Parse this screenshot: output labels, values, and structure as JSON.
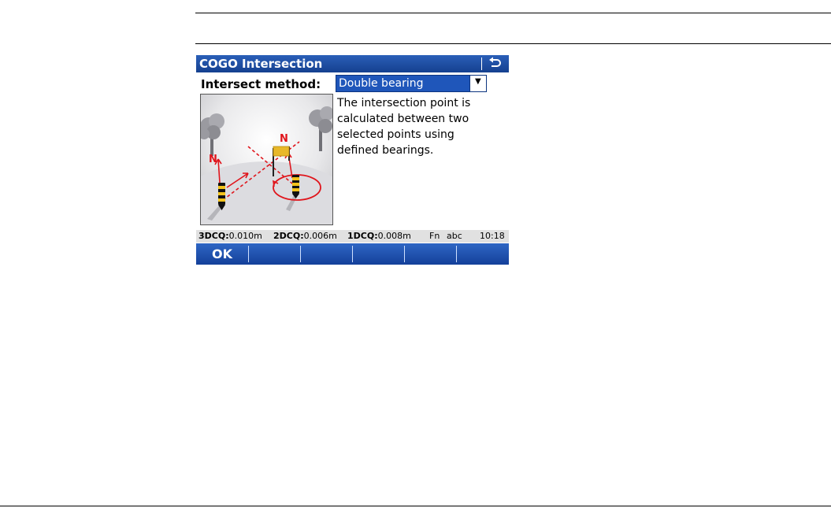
{
  "window": {
    "title": "COGO Intersection",
    "back_icon": "return-arrow-icon"
  },
  "form": {
    "method_label": "Intersect method:",
    "method_value": "Double bearing",
    "description_lines": [
      "The intersection point is",
      "calculated between two",
      "selected points using",
      "defined bearings."
    ]
  },
  "illustration": {
    "north_label": "N"
  },
  "status": {
    "q3_label": "3DCQ:",
    "q3_value": "0.010m",
    "q2_label": "2DCQ:",
    "q2_value": "0.006m",
    "q1_label": "1DCQ:",
    "q1_value": "0.008m",
    "fn": "Fn",
    "input_mode": "abc",
    "time": "10:18"
  },
  "softkeys": [
    "OK",
    "",
    "",
    "",
    "",
    ""
  ],
  "colors": {
    "titlebar": "#1f56ba",
    "accent_red": "#e0141b",
    "statusbar": "#e1e1e1"
  }
}
